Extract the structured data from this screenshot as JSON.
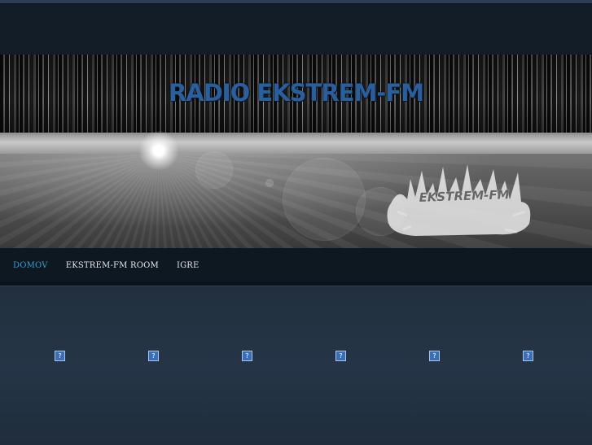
{
  "header": {
    "site_title": "RADIO EKSTREM-FM",
    "logo_text": "EKSTREM-FM"
  },
  "nav": {
    "items": [
      {
        "label": "DOMOV",
        "active": true
      },
      {
        "label": "EKSTREM-FM ROOM",
        "active": false
      },
      {
        "label": "IGRE",
        "active": false
      }
    ]
  },
  "content": {
    "broken_image_glyph": "?",
    "thumbnail_count": 6
  },
  "colors": {
    "accent": "#3e9bd6",
    "title_blue": "#2a5f9e",
    "background": "#1b2836"
  }
}
